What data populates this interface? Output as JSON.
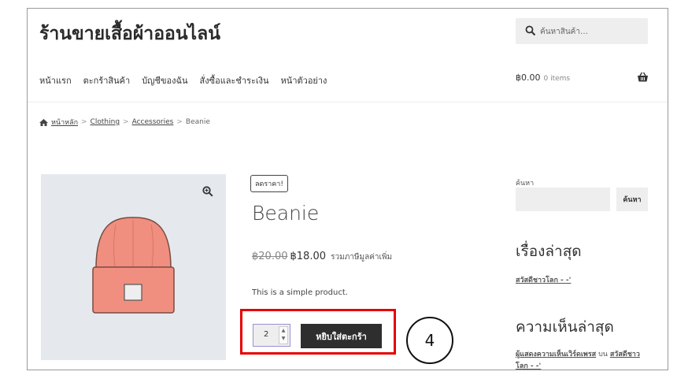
{
  "site": {
    "title": "ร้านขายเสื้อผ้าออนไลน์"
  },
  "search": {
    "placeholder": "ค้นหาสินค้า…"
  },
  "nav": {
    "items": [
      "หน้าแรก",
      "ตะกร้าสินค้า",
      "บัญชีของฉัน",
      "สั่งซื้อและชำระเงิน",
      "หน้าตัวอย่าง"
    ]
  },
  "cart": {
    "total": "฿0.00",
    "count": "0 items"
  },
  "breadcrumb": {
    "items": [
      "หน้าหลัก",
      "Clothing",
      "Accessories",
      "Beanie"
    ]
  },
  "product": {
    "badge": "ลดราคา!",
    "title": "Beanie",
    "old_price": "฿20.00",
    "price": "฿18.00",
    "vat_note": "รวมภาษีมูลค่าเพิ่ม",
    "short_description": "This is a simple product.",
    "quantity": "2",
    "add_to_cart_label": "หยิบใส่ตะกร้า",
    "hat_color": "#f08f7f"
  },
  "sidebar": {
    "search_label": "ค้นหา",
    "search_button": "ค้นหา",
    "recent_posts_title": "เรื่องล่าสุด",
    "recent_post": "สวัสดีชาวโลก - -'",
    "recent_comments_title": "ความเห็นล่าสุด",
    "comment_author": "ผู้แสดงความเห็นเวิร์ดเพรส",
    "comment_on": "บน",
    "comment_post": "สวัสดีชาวโลก - -'"
  },
  "annotation": {
    "step_number": "4",
    "highlight_color": "#e50000"
  }
}
